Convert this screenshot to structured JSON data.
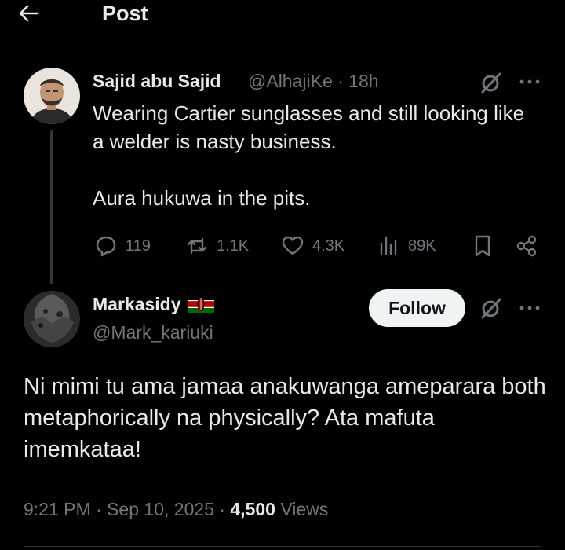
{
  "header": {
    "title": "Post"
  },
  "original_post": {
    "author_name": "Sajid abu Sajid",
    "handle_time": "@AlhajiKe · 18h",
    "text_line1": "Wearing Cartier sunglasses and still looking like a welder is nasty business.",
    "text_line2": "Aura hukuwa in the pits.",
    "stats": {
      "replies": "119",
      "reposts": "1.1K",
      "likes": "4.3K",
      "views": "89K"
    }
  },
  "reply": {
    "author_name": "Markasidy",
    "flag": "kenya-flag",
    "handle": "@Mark_kariuki",
    "follow_label": "Follow",
    "text": "Ni mimi tu ama jamaa anakuwanga ameparara both metaphorically na physically? Ata mafuta imemkataa!",
    "timestamp": "9:21 PM · Sep 10, 2025 · ",
    "views_count": "4,500",
    "views_label": " Views"
  },
  "colors": {
    "background": "#000000",
    "text_primary": "#e7e9ea",
    "text_secondary": "#71767b",
    "follow_bg": "#eff3f4",
    "thread_line": "#333639"
  },
  "icons": [
    "back-arrow-icon",
    "grok-icon",
    "more-icon",
    "reply-icon",
    "repost-icon",
    "like-icon",
    "views-icon",
    "bookmark-icon",
    "share-icon"
  ]
}
